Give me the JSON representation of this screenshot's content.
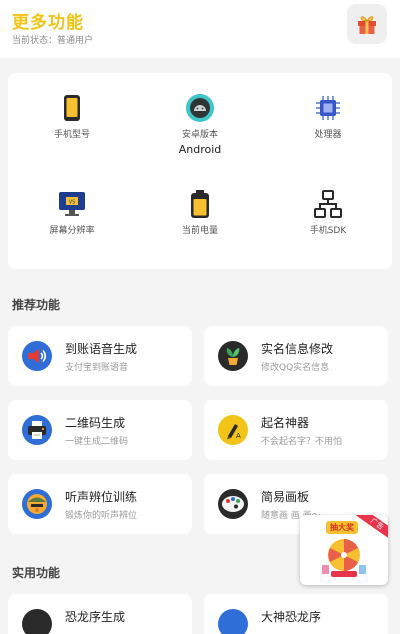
{
  "header": {
    "title": "更多功能",
    "status": "当前状态：普通用户",
    "gift_icon": "gift-icon"
  },
  "device": {
    "items": [
      {
        "label": "手机型号",
        "value": "",
        "icon": "phone-model-icon"
      },
      {
        "label": "安卓版本",
        "value": "Android",
        "icon": "android-icon"
      },
      {
        "label": "处理器",
        "value": "",
        "icon": "processor-icon"
      },
      {
        "label": "屏幕分辨率",
        "value": "",
        "icon": "screen-resolution-icon"
      },
      {
        "label": "当前电量",
        "value": "",
        "icon": "battery-icon"
      },
      {
        "label": "手机SDK",
        "value": "",
        "icon": "sdk-icon"
      }
    ]
  },
  "recommended": {
    "title": "推荐功能",
    "items": [
      {
        "name": "到账语音生成",
        "desc": "支付宝到账语音",
        "icon": "voice-icon"
      },
      {
        "name": "实名信息修改",
        "desc": "修改QQ实名信息",
        "icon": "plant-icon"
      },
      {
        "name": "二维码生成",
        "desc": "一键生成二维码",
        "icon": "printer-icon"
      },
      {
        "name": "起名神器",
        "desc": "不会起名字？不用怕",
        "icon": "pen-icon"
      },
      {
        "name": "听声辨位训练",
        "desc": "锻炼你的听声辨位",
        "icon": "soldier-icon"
      },
      {
        "name": "简易画板",
        "desc": "随意画 画 画～",
        "icon": "palette-icon"
      }
    ]
  },
  "practical": {
    "title": "实用功能",
    "items": [
      {
        "name": "恐龙序生成",
        "icon": "tool-icon-1"
      },
      {
        "name": "大神恐龙序",
        "icon": "tool-icon-2"
      }
    ]
  },
  "ad": {
    "banner": "抽大奖",
    "tag": "广告"
  },
  "colors": {
    "accent": "#f2c417",
    "background": "#f4f4f4",
    "card": "#ffffff"
  }
}
